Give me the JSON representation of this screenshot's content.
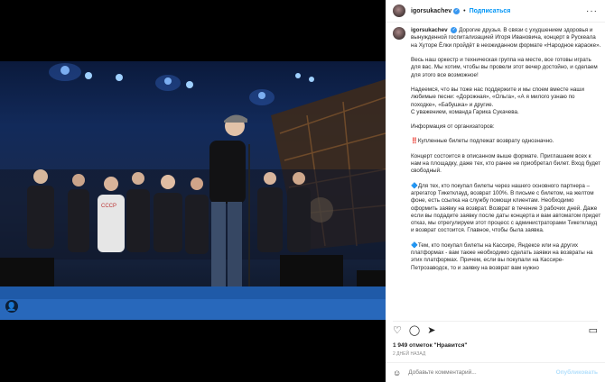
{
  "post": {
    "username": "igorsukachev",
    "follow_label": "Подписаться",
    "more_label": "···",
    "overlay_badge": "👤"
  },
  "caption": {
    "username": "igorsukachev",
    "intro": "Дорогие друзья. В связи с ухудшением здоровья и вынужденной госпитализацией Игоря Ивановича, концерт в Рускеала на Хуторе Ёлки пройдёт в неожиданном формате «Народное караоке».",
    "p1": "Весь наш оркестр и техническая группа на месте, все готовы играть для вас. Мы хотим, чтобы вы провели этот вечер достойно, и сделаем для этого все возможное!",
    "p2": "Надеемся, что вы тоже нас поддержите и мы споем вместе наши любимые песни: «Дорожная», «Ольга», «А я милого узнаю по походке», «Бабушка» и другие.\nС уважением, команда Гарика Сукачева.",
    "p3": "Информация от организаторов:",
    "p4": "‼️Купленные билеты подлежат возврату однозначно.",
    "p5": "Концерт состоится в описанном выше формате. Приглашаем всех к нам на площадку, даже тех, кто ранее не приобретал билет. Вход будет свободный.",
    "p6": "🔷Для тех, кто покупал билеты через нашего основного партнера – агрегатор Тикетклауд, возврат 100%. В письме с билетом, на желтом фоне, есть ссылка на службу помощи клиентам. Необходимо оформить заявку на возврат. Возврат в течение 3 рабочих дней. Даже если вы подадите заявку после даты концерта и вам автоматом придет отказ, мы отрегулируем этот процесс с администраторами Тикетклауд и возврат состоится. Главное, чтобы была заявка.",
    "p7": "🔷Тем, кто покупал билеты на Кассире, Яндексе или на других платформах - вам также необходимо сделать заявки на возвраты на этих платформах. Причем, если вы покупали на Кассире-Петрозаводск, то и заявку на возврат вам нужно"
  },
  "actions": {
    "like_icon": "heart-icon",
    "comment_icon": "comment-icon",
    "share_icon": "share-icon",
    "save_icon": "bookmark-icon"
  },
  "likes_text": "1 949 отметок \"Нравится\"",
  "date_text": "2 ДНЕЙ НАЗАД",
  "comment": {
    "placeholder": "Добавьте комментарий...",
    "publish_label": "Опубликовать"
  }
}
